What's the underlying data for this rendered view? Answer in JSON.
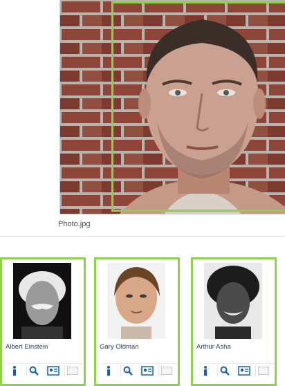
{
  "photo": {
    "filename": "Photo.jpg"
  },
  "candidates": [
    {
      "name": "Albert Einstein"
    },
    {
      "name": "Gary Oldman"
    },
    {
      "name": "Arthur Asha"
    }
  ],
  "icons": {
    "info": "info-icon",
    "zoom": "magnifier-icon",
    "profile": "profile-card-icon",
    "mail": "mail-icon"
  },
  "colors": {
    "match_border": "#8fd14f",
    "name_text": "#1f3f6b",
    "info_icon": "#1f5fa8"
  }
}
